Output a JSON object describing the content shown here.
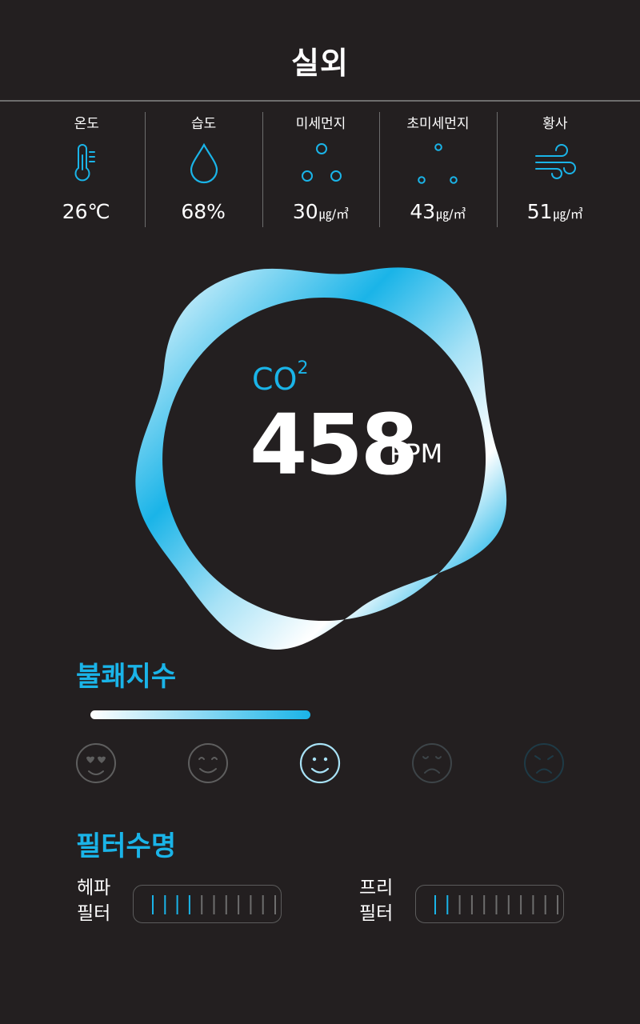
{
  "header": {
    "title": "실외"
  },
  "metrics": [
    {
      "label": "온도",
      "value": "26℃",
      "unit": "",
      "icon": "thermometer-icon"
    },
    {
      "label": "습도",
      "value": "68%",
      "unit": "",
      "icon": "water-drop-icon"
    },
    {
      "label": "미세먼지",
      "value": "30",
      "unit": "㎍/㎥",
      "icon": "fine-dust-icon"
    },
    {
      "label": "초미세먼지",
      "value": "43",
      "unit": "㎍/㎥",
      "icon": "ultrafine-dust-icon"
    },
    {
      "label": "황사",
      "value": "51",
      "unit": "㎍/㎥",
      "icon": "wind-icon"
    }
  ],
  "co2": {
    "label": "CO",
    "label_sup": "2",
    "value": "458",
    "unit": "PPM"
  },
  "comfort": {
    "title": "불쾌지수",
    "level_fraction": 0.45,
    "faces": [
      "heart-eyes-face-icon",
      "happy-face-icon",
      "smile-face-icon",
      "sad-face-icon",
      "angry-face-icon"
    ],
    "selected_index": 2
  },
  "filters": {
    "title": "필터수명",
    "items": [
      {
        "label_line1": "헤파",
        "label_line2": "필터",
        "segments_total": 11,
        "segments_filled": 4
      },
      {
        "label_line1": "프리",
        "label_line2": "필터",
        "segments_total": 11,
        "segments_filled": 2
      }
    ]
  },
  "colors": {
    "accent": "#1ab4e8",
    "background": "#231f20",
    "divider": "#6d6d6d",
    "inactive": "#5c5c5c"
  }
}
